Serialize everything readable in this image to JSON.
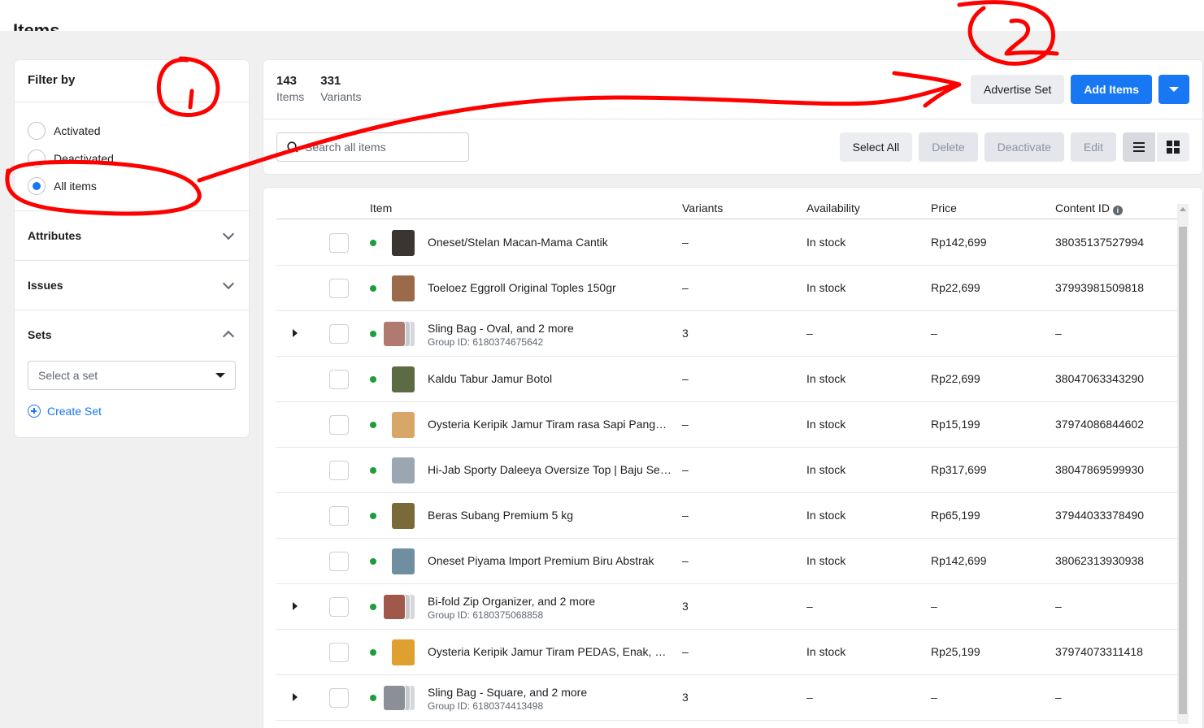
{
  "page": {
    "title": "Items"
  },
  "filter": {
    "heading": "Filter by",
    "options": [
      {
        "label": "Activated",
        "selected": false
      },
      {
        "label": "Deactivated",
        "selected": false
      },
      {
        "label": "All items",
        "selected": true
      }
    ],
    "sections": {
      "attributes": "Attributes",
      "issues": "Issues",
      "sets": "Sets"
    },
    "set_select_placeholder": "Select a set",
    "create_set": "Create Set"
  },
  "summary": {
    "items_count": "143",
    "items_label": "Items",
    "variants_count": "331",
    "variants_label": "Variants"
  },
  "actions": {
    "advertise_set": "Advertise Set",
    "add_items": "Add Items"
  },
  "toolbar": {
    "search_placeholder": "Search all items",
    "select_all": "Select All",
    "delete": "Delete",
    "deactivate": "Deactivate",
    "edit": "Edit"
  },
  "table": {
    "headers": {
      "item": "Item",
      "variants": "Variants",
      "availability": "Availability",
      "price": "Price",
      "content_id": "Content ID"
    },
    "rows": [
      {
        "name": "Oneset/Stelan Macan-Mama Cantik",
        "group_id": "",
        "variants": "–",
        "availability": "In stock",
        "price": "Rp142,699",
        "content_id": "38035137527994",
        "group": false,
        "thumb": "#3a3530"
      },
      {
        "name": "Toeloez Eggroll Original Toples 150gr",
        "group_id": "",
        "variants": "–",
        "availability": "In stock",
        "price": "Rp22,699",
        "content_id": "37993981509818",
        "group": false,
        "thumb": "#9a6a4a"
      },
      {
        "name": "Sling Bag - Oval, and 2 more",
        "group_id": "Group ID: 6180374675642",
        "variants": "3",
        "availability": "–",
        "price": "–",
        "content_id": "–",
        "group": true,
        "thumb": "#b07a70"
      },
      {
        "name": "Kaldu Tabur Jamur Botol",
        "group_id": "",
        "variants": "–",
        "availability": "In stock",
        "price": "Rp22,699",
        "content_id": "38047063343290",
        "group": false,
        "thumb": "#5d6b45"
      },
      {
        "name": "Oysteria Keripik Jamur Tiram rasa Sapi Panggang",
        "group_id": "",
        "variants": "–",
        "availability": "In stock",
        "price": "Rp15,199",
        "content_id": "37974086844602",
        "group": false,
        "thumb": "#d9a66a"
      },
      {
        "name": "Hi-Jab Sporty Daleeya Oversize Top | Baju Senam",
        "group_id": "",
        "variants": "–",
        "availability": "In stock",
        "price": "Rp317,699",
        "content_id": "38047869599930",
        "group": false,
        "thumb": "#9aa7b3"
      },
      {
        "name": "Beras Subang Premium 5 kg",
        "group_id": "",
        "variants": "–",
        "availability": "In stock",
        "price": "Rp65,199",
        "content_id": "37944033378490",
        "group": false,
        "thumb": "#7a6a3a"
      },
      {
        "name": "Oneset Piyama Import Premium Biru Abstrak",
        "group_id": "",
        "variants": "–",
        "availability": "In stock",
        "price": "Rp142,699",
        "content_id": "38062313930938",
        "group": false,
        "thumb": "#6f8fa0"
      },
      {
        "name": "Bi-fold Zip Organizer, and 2 more",
        "group_id": "Group ID: 6180375068858",
        "variants": "3",
        "availability": "–",
        "price": "–",
        "content_id": "–",
        "group": true,
        "thumb": "#a0584a"
      },
      {
        "name": "Oysteria Keripik Jamur Tiram PEDAS, Enak, Bergizi",
        "group_id": "",
        "variants": "–",
        "availability": "In stock",
        "price": "Rp25,199",
        "content_id": "37974073311418",
        "group": false,
        "thumb": "#e0a030"
      },
      {
        "name": "Sling Bag - Square, and 2 more",
        "group_id": "Group ID: 6180374413498",
        "variants": "3",
        "availability": "–",
        "price": "–",
        "content_id": "–",
        "group": true,
        "thumb": "#8a8f98"
      }
    ]
  },
  "annotations": {
    "marker_one": "1",
    "marker_two": "2"
  },
  "colors": {
    "accent": "#1877f2",
    "annotation": "#ff0000",
    "status_active": "#1e9e3a"
  }
}
